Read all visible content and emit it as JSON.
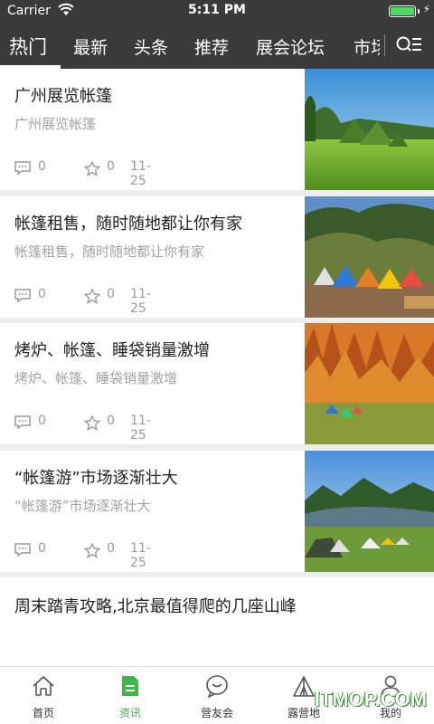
{
  "status_bar": {
    "carrier": "Carrier",
    "time": "5:11 PM",
    "battery_level": 1.0
  },
  "tabs": [
    "热门",
    "最新",
    "头条",
    "推荐",
    "展会论坛",
    "市场"
  ],
  "active_tab": 0,
  "articles": [
    {
      "title": "广州展览帐篷",
      "subtitle": "广州展览帐篷",
      "comments": "0",
      "likes": "0",
      "date": "11-25",
      "image": "green-meadow-tents"
    },
    {
      "title": "帐篷租售，随时随地都让你有家",
      "subtitle": "帐篷租售，随时随地都让你有家",
      "comments": "0",
      "likes": "0",
      "date": "11-25",
      "image": "colorful-tents-forest"
    },
    {
      "title": "烤炉、帐篷、睡袋销量激增",
      "subtitle": "烤炉、帐篷、睡袋销量激增",
      "comments": "0",
      "likes": "0",
      "date": "11-25",
      "image": "autumn-forest-tents"
    },
    {
      "title": "“帐篷游”市场逐渐壮大",
      "subtitle": "“帐篷游”市场逐渐壮大",
      "comments": "0",
      "likes": "0",
      "date": "11-25",
      "image": "mountain-lake-tents"
    },
    {
      "title": "周末踏青攻略,北京最值得爬的几座山峰"
    }
  ],
  "bottom_nav": [
    {
      "label": "首页",
      "icon": "home-icon"
    },
    {
      "label": "资讯",
      "icon": "news-icon"
    },
    {
      "label": "营友会",
      "icon": "chat-bubble-icon"
    },
    {
      "label": "露营地",
      "icon": "tent-icon"
    },
    {
      "label": "我的",
      "icon": "person-icon"
    }
  ],
  "active_nav": 1,
  "watermark": "ITMOP.COM",
  "colors": {
    "accent": "#3fb54a",
    "header_bg": "#3a3a3a"
  }
}
